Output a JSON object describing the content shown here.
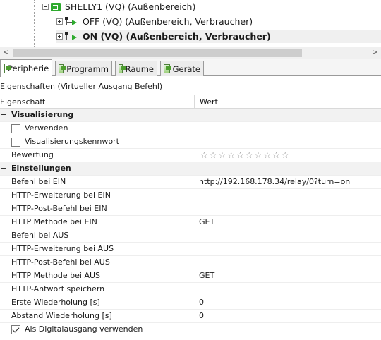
{
  "tree": {
    "items": [
      {
        "label": "SHELLY1 (VQ) (Außenbereich)",
        "expander": "minus",
        "icon": "shelly-device-icon"
      },
      {
        "label": "OFF (VQ) (Außenbereich, Verbraucher)",
        "expander": "plus",
        "icon": "output-off-icon"
      },
      {
        "label": "ON (VQ) (Außenbereich, Verbraucher)",
        "expander": "plus",
        "icon": "output-on-icon",
        "selected": true
      }
    ]
  },
  "scrollbar": {
    "left_arrow": "<",
    "right_arrow": ">"
  },
  "tabs": [
    {
      "label": "Peripherie",
      "active": true
    },
    {
      "label": "Programm",
      "active": false
    },
    {
      "label": "Räume",
      "active": false
    },
    {
      "label": "Geräte",
      "active": false
    }
  ],
  "properties": {
    "title": "Eigenschaften (Virtueller Ausgang Befehl)",
    "col_property": "Eigenschaft",
    "col_value": "Wert",
    "rows": [
      {
        "type": "category",
        "name": "Visualisierung"
      },
      {
        "type": "checkbox",
        "name": "Verwenden",
        "checked": false
      },
      {
        "type": "checkbox",
        "name": "Visualisierungskennwort",
        "checked": false
      },
      {
        "type": "rating",
        "name": "Bewertung",
        "stars_total": 10,
        "stars_filled": 0
      },
      {
        "type": "category",
        "name": "Einstellungen"
      },
      {
        "type": "text",
        "name": "Befehl bei EIN",
        "value": "http://192.168.178.34/relay/0?turn=on"
      },
      {
        "type": "text",
        "name": "HTTP-Erweiterung bei EIN",
        "value": ""
      },
      {
        "type": "text",
        "name": "HTTP-Post-Befehl bei EIN",
        "value": ""
      },
      {
        "type": "text",
        "name": "HTTP Methode bei EIN",
        "value": "GET"
      },
      {
        "type": "text",
        "name": "Befehl bei AUS",
        "value": ""
      },
      {
        "type": "text",
        "name": "HTTP-Erweiterung bei AUS",
        "value": ""
      },
      {
        "type": "text",
        "name": "HTTP-Post-Befehl bei AUS",
        "value": ""
      },
      {
        "type": "text",
        "name": "HTTP Methode bei AUS",
        "value": "GET"
      },
      {
        "type": "text",
        "name": "HTTP-Antwort speichern",
        "value": ""
      },
      {
        "type": "text",
        "name": "Erste Wiederholung [s]",
        "value": "0"
      },
      {
        "type": "text",
        "name": "Abstand Wiederholung [s]",
        "value": "0"
      },
      {
        "type": "checkbox",
        "name": "Als Digitalausgang verwenden",
        "checked": true
      }
    ]
  }
}
